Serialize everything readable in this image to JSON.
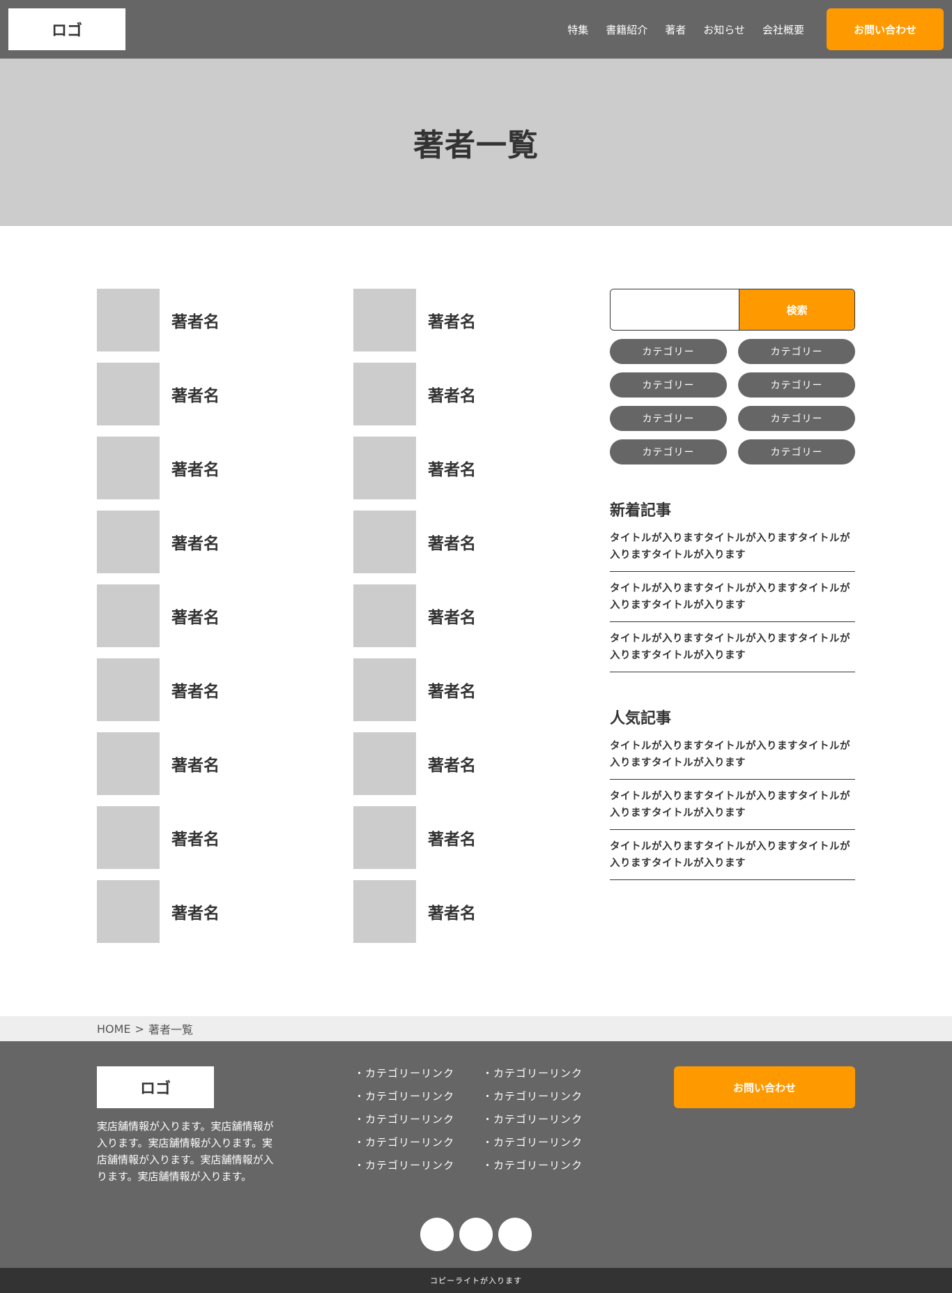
{
  "header": {
    "logo": "ロゴ",
    "nav": [
      "特集",
      "書籍紹介",
      "著者",
      "お知らせ",
      "会社概要"
    ],
    "contact_label": "お問い合わせ"
  },
  "hero": {
    "title": "著者一覧"
  },
  "authors": {
    "left": [
      "著者名",
      "著者名",
      "著者名",
      "著者名",
      "著者名",
      "著者名",
      "著者名",
      "著者名",
      "著者名"
    ],
    "right": [
      "著者名",
      "著者名",
      "著者名",
      "著者名",
      "著者名",
      "著者名",
      "著者名",
      "著者名",
      "著者名"
    ]
  },
  "sidebar": {
    "search": {
      "value": "",
      "button_label": "検索"
    },
    "categories": [
      "カテゴリー",
      "カテゴリー",
      "カテゴリー",
      "カテゴリー",
      "カテゴリー",
      "カテゴリー",
      "カテゴリー",
      "カテゴリー"
    ],
    "new_articles": {
      "heading": "新着記事",
      "items": [
        "タイトルが入りますタイトルが入りますタイトルが入りますタイトルが入ります",
        "タイトルが入りますタイトルが入りますタイトルが入りますタイトルが入ります",
        "タイトルが入りますタイトルが入りますタイトルが入りますタイトルが入ります"
      ]
    },
    "popular_articles": {
      "heading": "人気記事",
      "items": [
        "タイトルが入りますタイトルが入りますタイトルが入りますタイトルが入ります",
        "タイトルが入りますタイトルが入りますタイトルが入りますタイトルが入ります",
        "タイトルが入りますタイトルが入りますタイトルが入りますタイトルが入ります"
      ]
    }
  },
  "breadcrumb": {
    "home": "HOME",
    "separator": ">",
    "current": "著者一覧"
  },
  "footer": {
    "logo": "ロゴ",
    "info": "実店舗情報が入ります。実店舗情報が入ります。実店舗情報が入ります。実店舗情報が入ります。実店舗情報が入ります。実店舗情報が入ります。",
    "links": [
      "・カテゴリーリンク",
      "・カテゴリーリンク",
      "・カテゴリーリンク",
      "・カテゴリーリンク",
      "・カテゴリーリンク",
      "・カテゴリーリンク",
      "・カテゴリーリンク",
      "・カテゴリーリンク",
      "・カテゴリーリンク",
      "・カテゴリーリンク"
    ],
    "contact_label": "お問い合わせ",
    "social_icons": [
      "social-icon",
      "social-icon",
      "social-icon"
    ]
  },
  "copyright": "コピーライトが入ります",
  "colors": {
    "accent": "#ff9900",
    "header_bg": "#666666",
    "hero_bg": "#cccccc"
  }
}
